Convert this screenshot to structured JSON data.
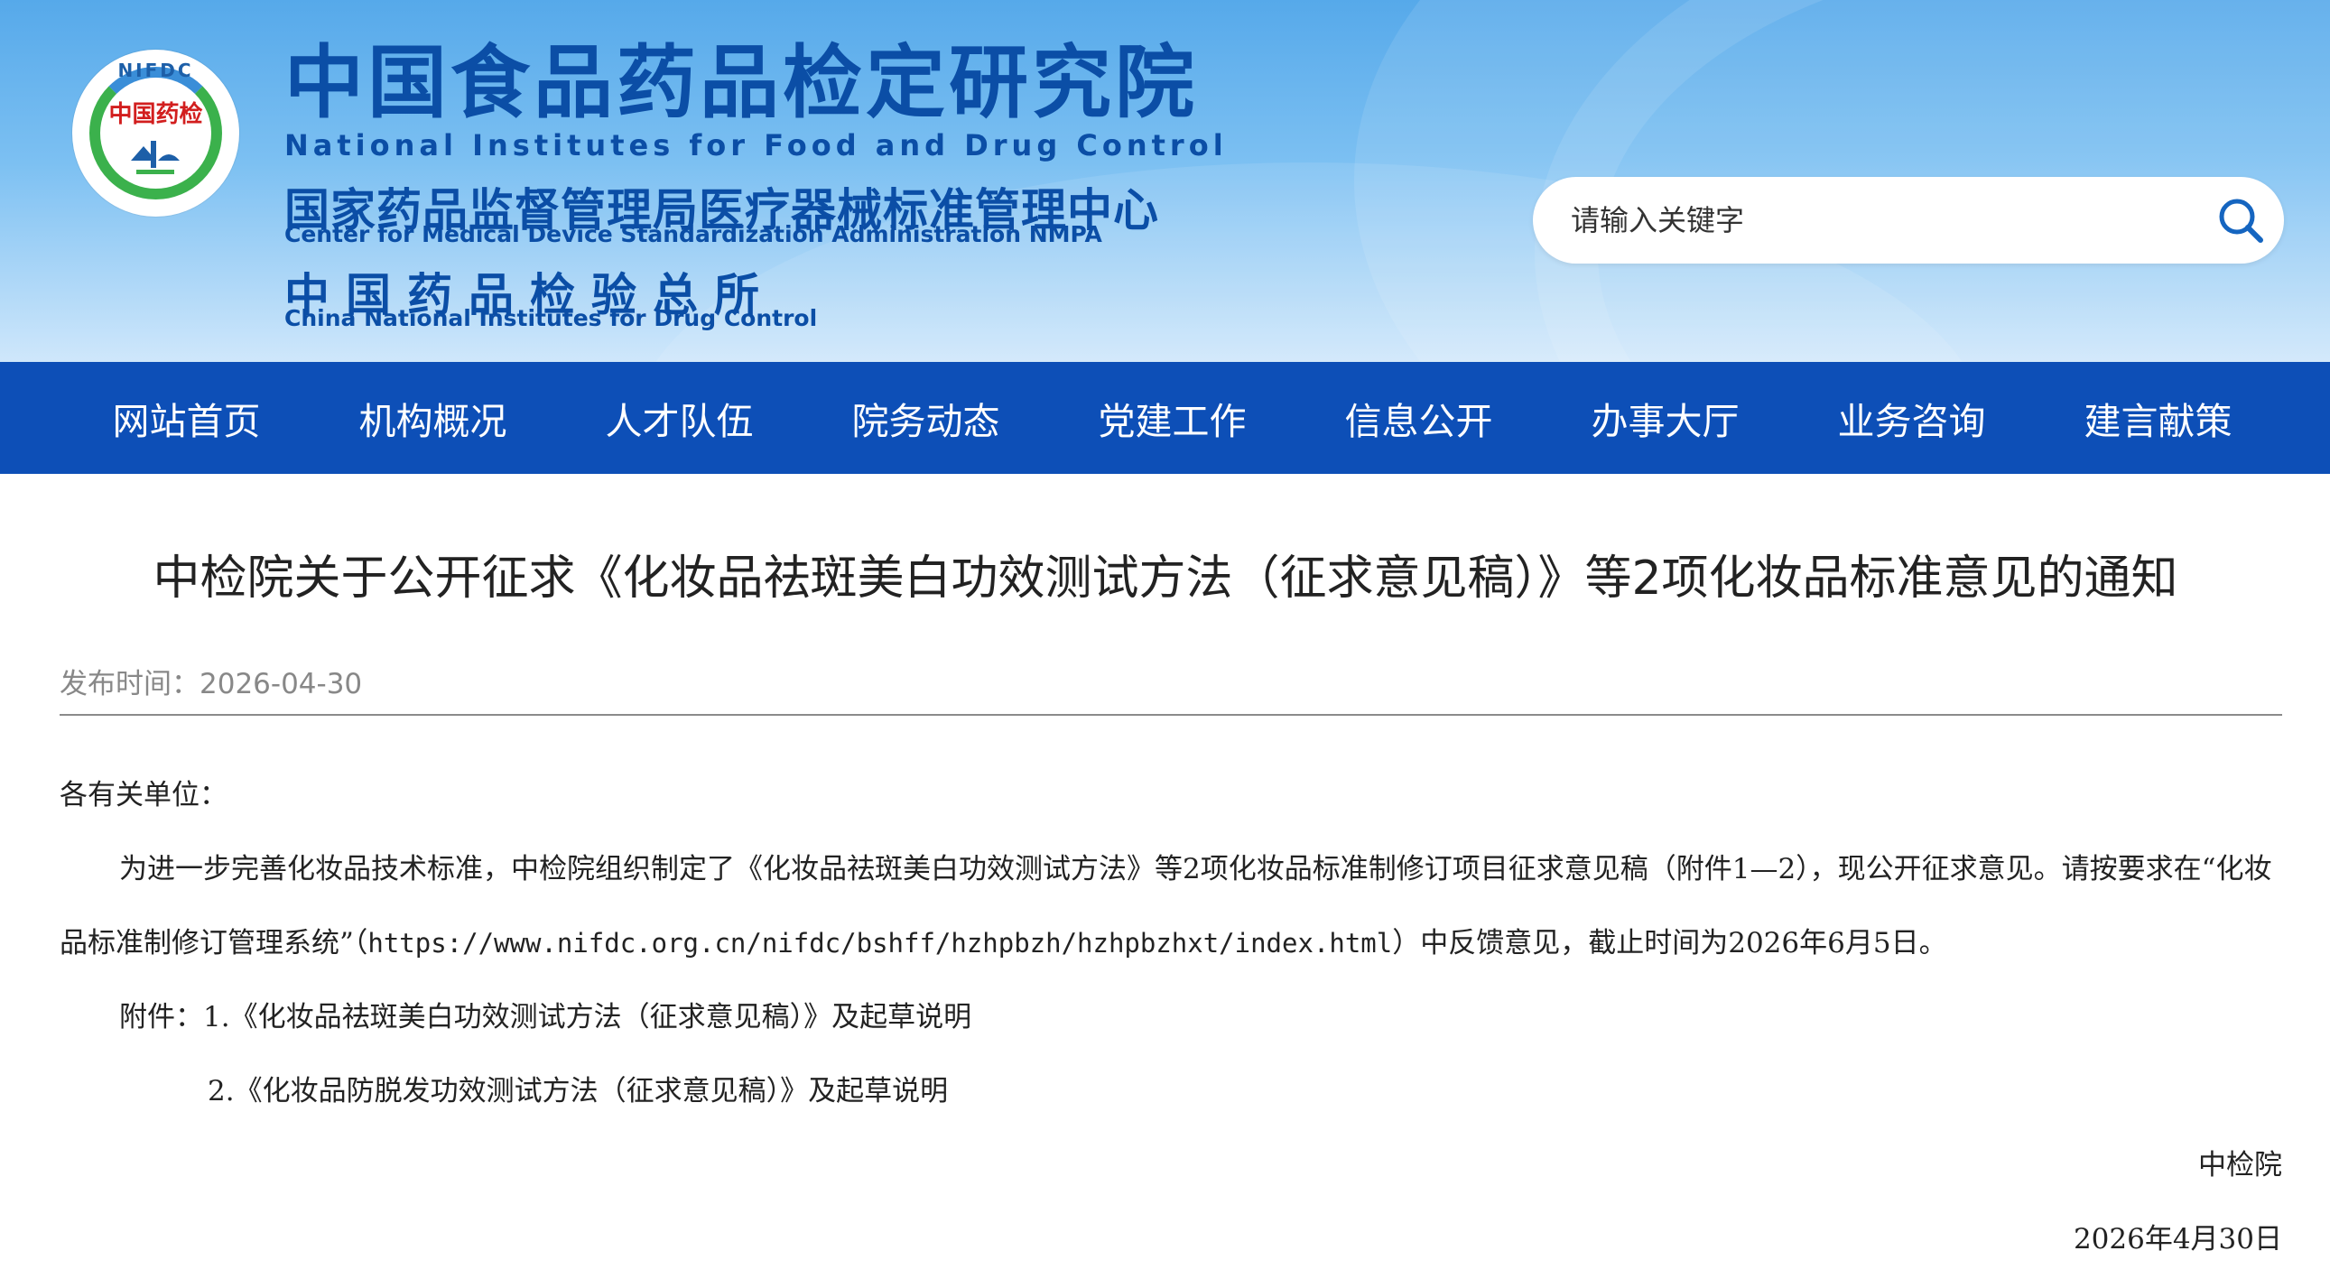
{
  "header": {
    "logo": {
      "arc_text": "NIFDC",
      "center_text": "中国药检"
    },
    "org_name_cn": "中国食品药品检定研究院",
    "org_name_en": "National Institutes for Food and Drug Control",
    "center_name_cn": "国家药品监督管理局医疗器械标准管理中心",
    "center_name_en": "Center for Medical Device Standardization Administration NMPA",
    "inst_name_cn": "中国药品检验总所",
    "inst_name_en": "China National Institutes for Drug Control"
  },
  "search": {
    "placeholder": "请输入关键字",
    "icon": "search-icon"
  },
  "nav": {
    "items": [
      {
        "label": "网站首页"
      },
      {
        "label": "机构概况"
      },
      {
        "label": "人才队伍"
      },
      {
        "label": "院务动态"
      },
      {
        "label": "党建工作"
      },
      {
        "label": "信息公开"
      },
      {
        "label": "办事大厅"
      },
      {
        "label": "业务咨询"
      },
      {
        "label": "建言献策"
      }
    ]
  },
  "article": {
    "title": "中检院关于公开征求《化妆品祛斑美白功效测试方法（征求意见稿）》等2项化妆品标准意见的通知",
    "publish_label": "发布时间：",
    "publish_date": "2026-04-30",
    "salutation": "各有关单位：",
    "paragraph_part1": "为进一步完善化妆品技术标准，中检院组织制定了《化妆品祛斑美白功效测试方法》等2项化妆品标准制修订项目征求意见稿（附件1—2），现公开征求意见。请按要",
    "paragraph_part2_prefix": "求在“化妆品标准制修订管理系统”（",
    "paragraph_url": "https://www.nifdc.org.cn/nifdc/bshff/hzhpbzh/hzhpbzhxt/index.html",
    "paragraph_part2_suffix": "）中反馈意见，截止时间为2026年6月5日。",
    "attachment_label": "附件：",
    "attachment_1": "1.《化妆品祛斑美白功效测试方法（征求意见稿）》及起草说明",
    "attachment_2": "2.《化妆品防脱发功效测试方法（征求意见稿）》及起草说明",
    "signature": "中检院",
    "date": "2026年4月30日"
  },
  "colors": {
    "nav_bg": "#0d4fb7",
    "brand_blue": "#0b4ea6",
    "header_sky": "#56a9ea"
  }
}
